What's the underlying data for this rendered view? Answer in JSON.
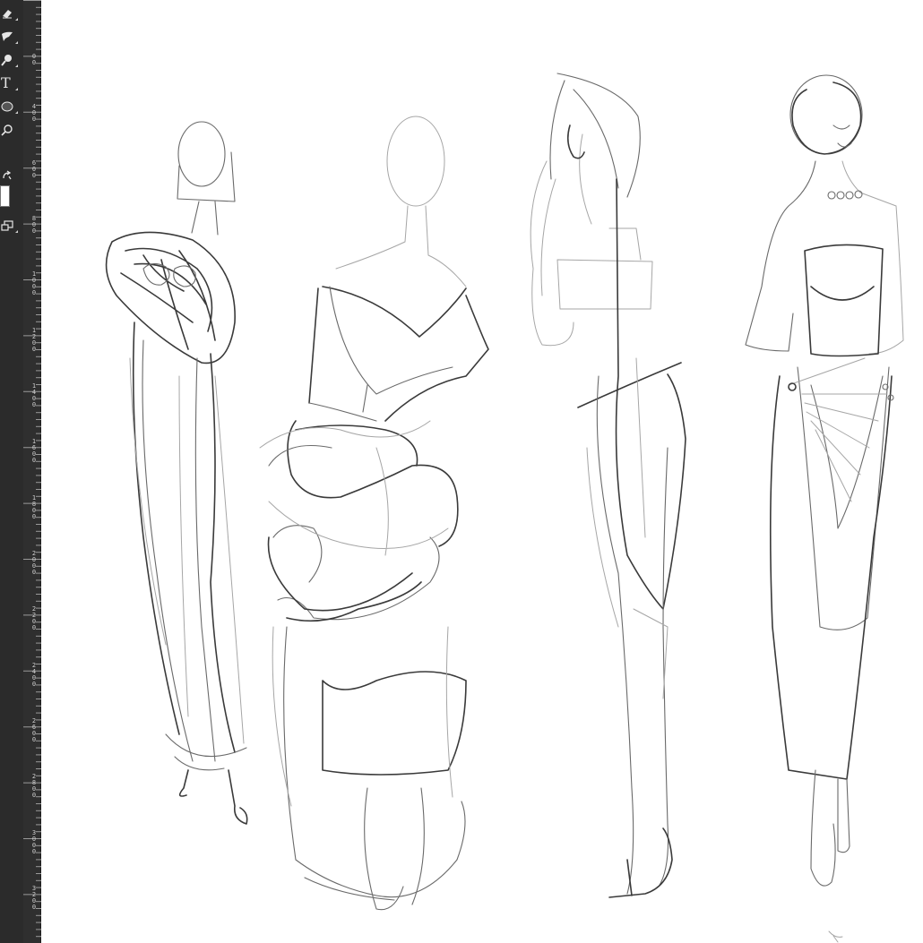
{
  "toolbar": {
    "tools": [
      {
        "name": "eraser-tool",
        "icon": "eraser-icon"
      },
      {
        "name": "brush-tool",
        "icon": "brush-icon"
      },
      {
        "name": "dodge-tool",
        "icon": "dodge-icon"
      },
      {
        "name": "type-tool",
        "icon": "type-icon",
        "glyph": "T"
      },
      {
        "name": "ellipse-tool",
        "icon": "ellipse-icon"
      },
      {
        "name": "zoom-tool",
        "icon": "zoom-icon"
      },
      {
        "name": "swap-colors",
        "icon": "swap-icon"
      },
      {
        "name": "screen-mode",
        "icon": "screen-mode-icon"
      }
    ],
    "foreground_color": "#ffffff"
  },
  "ruler": {
    "labels": [
      "00",
      "400",
      "600",
      "800",
      "1000",
      "1200",
      "1400",
      "1600",
      "1800",
      "2000",
      "2200",
      "2400",
      "2600",
      "2800",
      "3000",
      "3200"
    ]
  },
  "colors": {
    "toolbar_bg": "#2b2b2b",
    "ruler_bg": "#2f2f2f",
    "canvas_bg": "#ffffff",
    "sketch_dark": "#3a3a3a",
    "sketch_light": "#a6a6a6"
  }
}
